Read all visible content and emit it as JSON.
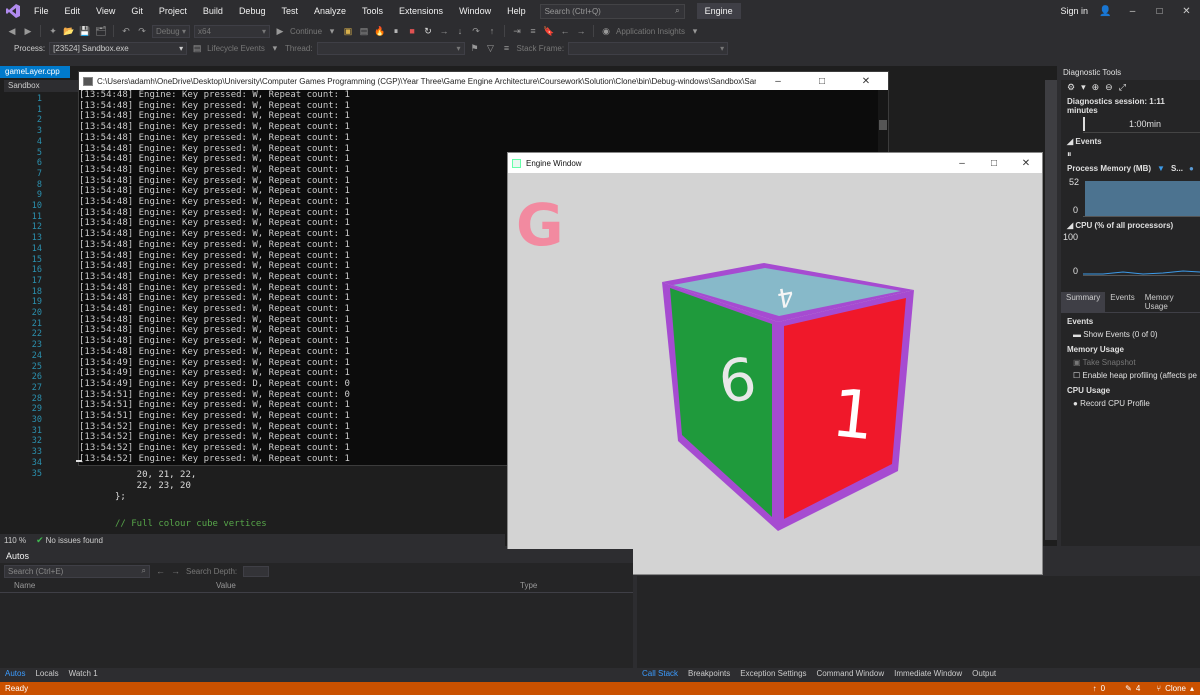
{
  "menubar": {
    "items": [
      "File",
      "Edit",
      "View",
      "Git",
      "Project",
      "Build",
      "Debug",
      "Test",
      "Analyze",
      "Tools",
      "Extensions",
      "Window",
      "Help"
    ],
    "search_placeholder": "Search (Ctrl+Q)",
    "solution_name": "Engine",
    "signin": "Sign in"
  },
  "toolbar": {
    "config": "Debug",
    "platform": "x64",
    "continue": "Continue",
    "app_insights": "Application Insights",
    "process_label": "Process:",
    "process_value": "[23524] Sandbox.exe",
    "lifecycle": "Lifecycle Events",
    "thread_label": "Thread:",
    "stack_frame": "Stack Frame:"
  },
  "editor": {
    "tab": "gameLayer.cpp",
    "nav": "Sandbox",
    "zoom": "110 %",
    "issues": "No issues found",
    "line_numbers": [
      "1",
      "1",
      "2",
      "3",
      "4",
      "5",
      "6",
      "7",
      "8",
      "9",
      "10",
      "11",
      "12",
      "13",
      "14",
      "15",
      "16",
      "17",
      "18",
      "19",
      "20",
      "21",
      "22",
      "23",
      "24",
      "25",
      "26",
      "27",
      "28",
      "29",
      "30",
      "31",
      "32",
      "33",
      "34",
      "35"
    ],
    "code": [
      {
        "text": "    20, 21, 22,",
        "comment": false
      },
      {
        "text": "    22, 23, 20",
        "comment": false
      },
      {
        "text": "};",
        "comment": false
      },
      {
        "text": "",
        "comment": false
      },
      {
        "text": "// Full colour cube vertices",
        "comment": true
      }
    ]
  },
  "console": {
    "title": "C:\\Users\\adamh\\OneDrive\\Desktop\\University\\Computer Games Programming (CGP)\\Year Three\\Game Engine Architecture\\Coursework\\Solution\\Clone\\bin\\Debug-windows\\Sandbox\\Sandbox.exe",
    "lines": [
      "[13:54:48] Engine: Key pressed: W, Repeat count: 1",
      "[13:54:48] Engine: Key pressed: W, Repeat count: 1",
      "[13:54:48] Engine: Key pressed: W, Repeat count: 1",
      "[13:54:48] Engine: Key pressed: W, Repeat count: 1",
      "[13:54:48] Engine: Key pressed: W, Repeat count: 1",
      "[13:54:48] Engine: Key pressed: W, Repeat count: 1",
      "[13:54:48] Engine: Key pressed: W, Repeat count: 1",
      "[13:54:48] Engine: Key pressed: W, Repeat count: 1",
      "[13:54:48] Engine: Key pressed: W, Repeat count: 1",
      "[13:54:48] Engine: Key pressed: W, Repeat count: 1",
      "[13:54:48] Engine: Key pressed: W, Repeat count: 1",
      "[13:54:48] Engine: Key pressed: W, Repeat count: 1",
      "[13:54:48] Engine: Key pressed: W, Repeat count: 1",
      "[13:54:48] Engine: Key pressed: W, Repeat count: 1",
      "[13:54:48] Engine: Key pressed: W, Repeat count: 1",
      "[13:54:48] Engine: Key pressed: W, Repeat count: 1",
      "[13:54:48] Engine: Key pressed: W, Repeat count: 1",
      "[13:54:48] Engine: Key pressed: W, Repeat count: 1",
      "[13:54:48] Engine: Key pressed: W, Repeat count: 1",
      "[13:54:48] Engine: Key pressed: W, Repeat count: 1",
      "[13:54:48] Engine: Key pressed: W, Repeat count: 1",
      "[13:54:48] Engine: Key pressed: W, Repeat count: 1",
      "[13:54:48] Engine: Key pressed: W, Repeat count: 1",
      "[13:54:48] Engine: Key pressed: W, Repeat count: 1",
      "[13:54:48] Engine: Key pressed: W, Repeat count: 1",
      "[13:54:49] Engine: Key pressed: W, Repeat count: 1",
      "[13:54:49] Engine: Key pressed: W, Repeat count: 1",
      "[13:54:49] Engine: Key pressed: D, Repeat count: 0",
      "[13:54:51] Engine: Key pressed: W, Repeat count: 0",
      "[13:54:51] Engine: Key pressed: W, Repeat count: 1",
      "[13:54:51] Engine: Key pressed: W, Repeat count: 1",
      "[13:54:52] Engine: Key pressed: W, Repeat count: 1",
      "[13:54:52] Engine: Key pressed: W, Repeat count: 1",
      "[13:54:52] Engine: Key pressed: W, Repeat count: 1",
      "[13:54:52] Engine: Key pressed: W, Repeat count: 1"
    ]
  },
  "engine_window": {
    "title": "Engine Window",
    "logo_letter": "G",
    "face_front": "1",
    "face_left": "6",
    "face_top": "4",
    "colors": {
      "logo": "#f28aa0",
      "front": "#f0182a",
      "left": "#1f9a3c",
      "top": "#87b9c9",
      "edge": "#a64bd1",
      "background": "#d3d3d3"
    }
  },
  "diagnostics": {
    "title": "Diagnostic Tools",
    "session": "Diagnostics session: 1:11 minutes",
    "timeline_label": "1:00min",
    "events_label": "Events",
    "memory_label": "Process Memory (MB)",
    "memory_legend": "S...",
    "memory_max": "52",
    "memory_min": "0",
    "cpu_label": "CPU (% of all processors)",
    "cpu_max": "100",
    "cpu_min": "0",
    "tabs": [
      "Summary",
      "Events",
      "Memory Usage"
    ],
    "sections": {
      "events": "Events",
      "show_events": "Show Events (0 of 0)",
      "memory_usage": "Memory Usage",
      "take_snapshot": "Take Snapshot",
      "heap_profiling": "Enable heap profiling (affects pe",
      "cpu_usage": "CPU Usage",
      "record_cpu": "Record CPU Profile"
    }
  },
  "autos": {
    "title": "Autos",
    "search_placeholder": "Search (Ctrl+E)",
    "search_depth": "Search Depth:",
    "columns": [
      "Name",
      "Value",
      "Type"
    ],
    "tabs": [
      "Autos",
      "Locals",
      "Watch 1"
    ]
  },
  "callstack": {
    "tabs": [
      "Call Stack",
      "Breakpoints",
      "Exception Settings",
      "Command Window",
      "Immediate Window",
      "Output"
    ]
  },
  "status": {
    "ready": "Ready",
    "errors": "0",
    "pencil": "4",
    "repo": "Clone"
  }
}
